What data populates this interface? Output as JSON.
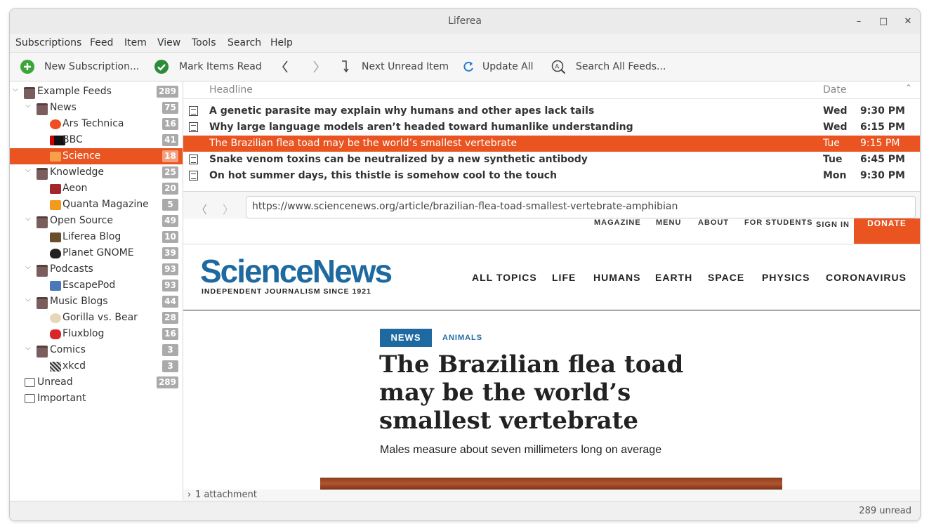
{
  "window": {
    "title": "Liferea"
  },
  "menu": [
    "Subscriptions",
    "Feed",
    "Item",
    "View",
    "Tools",
    "Search",
    "Help"
  ],
  "toolbar": {
    "new_subscription": "New Subscription...",
    "mark_items_read": "Mark Items Read",
    "next_unread": "Next Unread Item",
    "update_all": "Update All",
    "search_all": "Search All Feeds..."
  },
  "feeds": {
    "example_feeds": {
      "label": "Example Feeds",
      "count": "289"
    },
    "news": {
      "label": "News",
      "count": "75"
    },
    "ars": {
      "label": "Ars Technica",
      "count": "16"
    },
    "bbc": {
      "label": "BBC",
      "count": "41"
    },
    "science": {
      "label": "Science",
      "count": "18"
    },
    "knowledge": {
      "label": "Knowledge",
      "count": "25"
    },
    "aeon": {
      "label": "Aeon",
      "count": "20"
    },
    "quanta": {
      "label": "Quanta Magazine",
      "count": "5"
    },
    "open_source": {
      "label": "Open Source",
      "count": "49"
    },
    "liferea_blog": {
      "label": "Liferea Blog",
      "count": "10"
    },
    "planet_gnome": {
      "label": "Planet GNOME",
      "count": "39"
    },
    "podcasts": {
      "label": "Podcasts",
      "count": "93"
    },
    "escapepod": {
      "label": "EscapePod",
      "count": "93"
    },
    "music_blogs": {
      "label": "Music Blogs",
      "count": "44"
    },
    "gorilla": {
      "label": "Gorilla vs. Bear",
      "count": "28"
    },
    "fluxblog": {
      "label": "Fluxblog",
      "count": "16"
    },
    "comics": {
      "label": "Comics",
      "count": "3"
    },
    "xkcd": {
      "label": "xkcd",
      "count": "3"
    },
    "unread": {
      "label": "Unread",
      "count": "289"
    },
    "important": {
      "label": "Important"
    }
  },
  "headlines": {
    "col_headline": "Headline",
    "col_date": "Date",
    "items": [
      {
        "title": "A genetic parasite may explain why humans and other apes lack tails",
        "day": "Wed",
        "time": "9:30 PM"
      },
      {
        "title": "Why large language models aren’t headed toward humanlike understanding",
        "day": "Wed",
        "time": "6:15 PM"
      },
      {
        "title": "The Brazilian flea toad may be the world’s smallest vertebrate",
        "day": "Tue",
        "time": "9:15 PM"
      },
      {
        "title": "Snake venom toxins can be neutralized by a new synthetic antibody",
        "day": "Tue",
        "time": "6:45 PM"
      },
      {
        "title": "On hot summer days, this thistle is somehow cool to the touch",
        "day": "Mon",
        "time": "9:30 PM"
      }
    ]
  },
  "browser": {
    "url": "https://www.sciencenews.org/article/brazilian-flea-toad-smallest-vertebrate-amphibian"
  },
  "page": {
    "top_links": [
      "MAGAZINE",
      "MENU",
      "ABOUT",
      "FOR STUDENTS",
      "SIGN IN"
    ],
    "donate": "DONATE",
    "logo": "ScienceNews",
    "tagline": "INDEPENDENT JOURNALISM SINCE 1921",
    "nav": [
      "ALL TOPICS",
      "LIFE",
      "HUMANS",
      "EARTH",
      "SPACE",
      "PHYSICS",
      "CORONAVIRUS"
    ],
    "badge": "NEWS",
    "category": "ANIMALS",
    "headline_l1": "The Brazilian flea toad",
    "headline_l2": "may be the world’s",
    "headline_l3": "smallest vertebrate",
    "dek": "Males measure about seven millimeters long on average"
  },
  "attachment": "1 attachment",
  "status": "289 unread",
  "colors": {
    "accent": "#e95420",
    "sn_blue": "#1e6aa0",
    "sn_navy": "#0a2b4a"
  }
}
